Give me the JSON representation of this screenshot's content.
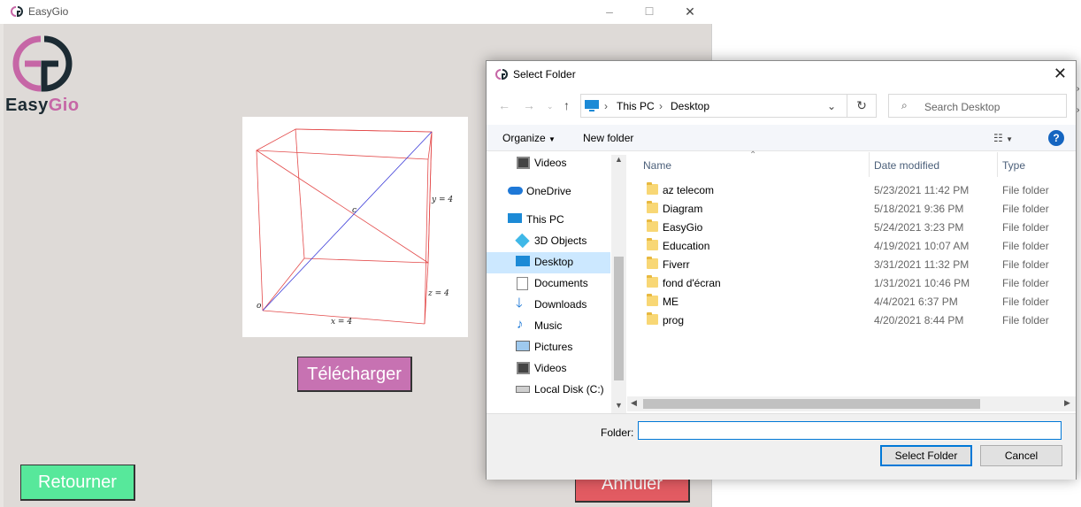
{
  "app": {
    "window_title": "EasyGio",
    "logo_text_part1": "Easy",
    "logo_text_part2": "Gio",
    "download_button": "Télécharger",
    "back_button": "Retourner",
    "cancel_button": "Annuler",
    "colors": {
      "download": "#c772b2",
      "back": "#57e89b",
      "cancel": "#e25b62",
      "background": "#dedad7"
    }
  },
  "figure": {
    "labels": {
      "c": "c",
      "y": "y = 4",
      "z": "z = 4",
      "x": "x = 4",
      "origin": "o"
    },
    "edge_color": "#e34a4a",
    "diagonal_color": "#3a3ad8"
  },
  "dialog": {
    "title": "Select Folder",
    "address": {
      "segments": [
        "This PC",
        "Desktop"
      ]
    },
    "search_placeholder": "Search Desktop",
    "toolbar": {
      "organize": "Organize",
      "new_folder": "New folder"
    },
    "nav": {
      "items": [
        {
          "label": "Videos",
          "icon": "video-icon"
        },
        {
          "label": "OneDrive",
          "icon": "cloud-icon"
        },
        {
          "label": "This PC",
          "icon": "computer-icon"
        },
        {
          "label": "3D Objects",
          "icon": "cube-icon"
        },
        {
          "label": "Desktop",
          "icon": "desktop-icon"
        },
        {
          "label": "Documents",
          "icon": "document-icon"
        },
        {
          "label": "Downloads",
          "icon": "download-icon"
        },
        {
          "label": "Music",
          "icon": "music-icon"
        },
        {
          "label": "Pictures",
          "icon": "picture-icon"
        },
        {
          "label": "Videos",
          "icon": "video-icon"
        },
        {
          "label": "Local Disk (C:)",
          "icon": "disk-icon"
        }
      ],
      "selected": "Desktop"
    },
    "columns": {
      "name": "Name",
      "date": "Date modified",
      "type": "Type"
    },
    "rows": [
      {
        "name": "az telecom",
        "date": "5/23/2021 11:42 PM",
        "type": "File folder"
      },
      {
        "name": "Diagram",
        "date": "5/18/2021 9:36 PM",
        "type": "File folder"
      },
      {
        "name": "EasyGio",
        "date": "5/24/2021 3:23 PM",
        "type": "File folder"
      },
      {
        "name": "Education",
        "date": "4/19/2021 10:07 AM",
        "type": "File folder"
      },
      {
        "name": "Fiverr",
        "date": "3/31/2021 11:32 PM",
        "type": "File folder"
      },
      {
        "name": "fond d'écran",
        "date": "1/31/2021 10:46 PM",
        "type": "File folder"
      },
      {
        "name": "ME",
        "date": "4/4/2021 6:37 PM",
        "type": "File folder"
      },
      {
        "name": "prog",
        "date": "4/20/2021 8:44 PM",
        "type": "File folder"
      }
    ],
    "folder_label": "Folder:",
    "folder_value": "",
    "select_button": "Select Folder",
    "cancel_button": "Cancel"
  }
}
